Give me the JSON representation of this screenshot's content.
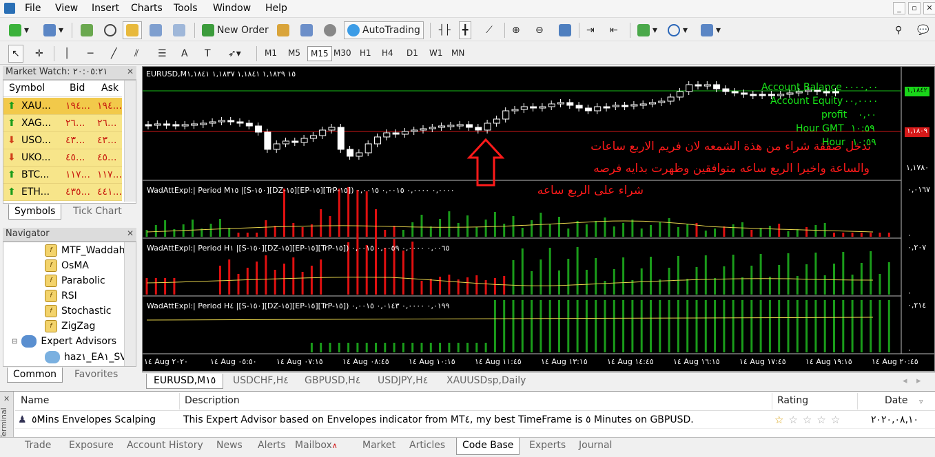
{
  "menu": [
    "File",
    "View",
    "Insert",
    "Charts",
    "Tools",
    "Window",
    "Help"
  ],
  "toolbar": {
    "new_order": "New Order",
    "autotrading": "AutoTrading"
  },
  "timeframes": [
    "M1",
    "M5",
    "M15",
    "M30",
    "H1",
    "H4",
    "D1",
    "W1",
    "MN"
  ],
  "active_timeframe": "M15",
  "market_watch": {
    "title": "Market Watch: ٢٠:٠٥:٢١",
    "headers": {
      "symbol": "Symbol",
      "bid": "Bid",
      "ask": "Ask"
    },
    "rows": [
      {
        "symbol": "XAU...",
        "bid": "١٩٤...",
        "ask": "١٩٤...",
        "dir": "up"
      },
      {
        "symbol": "XAG...",
        "bid": "٢٦...",
        "ask": "٢٦...",
        "dir": "up"
      },
      {
        "symbol": "USO...",
        "bid": "٤٣...",
        "ask": "٤٣...",
        "dir": "down"
      },
      {
        "symbol": "UKO...",
        "bid": "٤٥...",
        "ask": "٤٥...",
        "dir": "down"
      },
      {
        "symbol": "BTC...",
        "bid": "١١٧...",
        "ask": "١١٧...",
        "dir": "up"
      },
      {
        "symbol": "ETH...",
        "bid": "٤٣٥...",
        "ask": "٤٤١...",
        "dir": "up"
      }
    ],
    "tabs": [
      "Symbols",
      "Tick Chart"
    ]
  },
  "navigator": {
    "title": "Navigator",
    "items": [
      "MTF_Waddah",
      "OsMA",
      "Parabolic",
      "RSI",
      "Stochastic",
      "ZigZag"
    ],
    "expert_advisors": "Expert Advisors",
    "ea_item": "haz١_EA١_SV",
    "tabs": [
      "Common",
      "Favorites"
    ]
  },
  "chart": {
    "header": "EURUSD,M١٥  ١,١٨٢٩ ١,١٨٤١ ١,١٨٣٧ ١,١٨٤١",
    "labels": {
      "balance": "Account Balance",
      "balance_val": "٠٠٠٠,٠٠",
      "equity": "Account Equity",
      "equity_val": "٠٠,٠٠٠٠",
      "profit": "profit",
      "profit_val": "٠,٠٠",
      "hour_gmt": "Hour GMT",
      "hour_gmt_val": "١٠:٥٩",
      "hour": "Hour",
      "hour_val": "١٠:٥٩"
    },
    "annotation": [
      "تدخل صفقة  شراء من هذة الشمعه لان فريم الاربع ساعات",
      "والساعة  واخيرا الربع ساعه متوافقين وظهرت بدايه فرصه",
      "شراء على الربع ساعه"
    ],
    "price_tags": {
      "current": "١,١٨٤٢",
      "red_line": "١,١٨٠٩",
      "scale_low": "١,١٧٨٠"
    },
    "indicators": [
      {
        "title": "WadAttExpl:| Period M١٥ |[S-١٥٠][DZ-١٥][EP-١٥][TrP-١٥]) ٠,٠٠٠٠ ٠,٠٠٠٠ ٠,٠٠١٥ ٠,٠٠١٥",
        "scale_top": "٠,٠١٦٧",
        "scale_bot": "٠"
      },
      {
        "title": "WadAttExpl:| Period H١ |[S-١٥٠][DZ-١٥][EP-١٥][TrP-١٥]) ٠,٠٠٦٥ ٠,٠٠٠٠ ٠,٠٠٥٩ ٠,٠٠١٥",
        "scale_top": "٠,٢٠٧",
        "scale_bot": "٠"
      },
      {
        "title": "WadAttExpl:| Period H٤ |[S-١٥٠][DZ-١٥][EP-١٥][TrP-١٥]) ٠,٠١٩٩ ٠,٠٠٠٠ ٠,٠١٤٣ ٠,٠٠١٥",
        "scale_top": "٠,٢١٤",
        "scale_bot": "٠"
      }
    ],
    "time_axis": [
      "١٤ Aug ٢٠٢٠",
      "١٤ Aug ٠٥:٥٠",
      "١٤ Aug ٠٧:١٥",
      "١٤ Aug ٠٨:٤٥",
      "١٤ Aug ١٠:١٥",
      "١٤ Aug ١١:٤٥",
      "١٤ Aug ١٣:١٥",
      "١٤ Aug ١٤:٤٥",
      "١٤ Aug ١٦:١٥",
      "١٤ Aug ١٧:٤٥",
      "١٤ Aug ١٩:١٥",
      "١٤ Aug ٢٠:٤٥"
    ]
  },
  "chart_tabs": [
    "EURUSD,M١٥",
    "USDCHF,H٤",
    "GBPUSD,H٤",
    "USDJPY,H٤",
    "XAUUSDsp,Daily"
  ],
  "terminal": {
    "headers": {
      "name": "Name",
      "description": "Description",
      "rating": "Rating",
      "date": "Date"
    },
    "row": {
      "name": "٥Mins Envelopes Scalping",
      "description": "This Expert Advisor based on Envelopes indicator from MT٤, my best TimeFrame is ٥ Minutes on GBPUSD.",
      "rating": 1,
      "date": "٢٠٢٠,٠٨,١٠"
    },
    "side_label": "Terminal",
    "tabs": [
      "Trade",
      "Exposure",
      "Account History",
      "News",
      "Alerts",
      "Mailbox",
      "Market",
      "Articles",
      "Code Base",
      "Experts",
      "Journal"
    ],
    "active_tab": "Code Base"
  }
}
